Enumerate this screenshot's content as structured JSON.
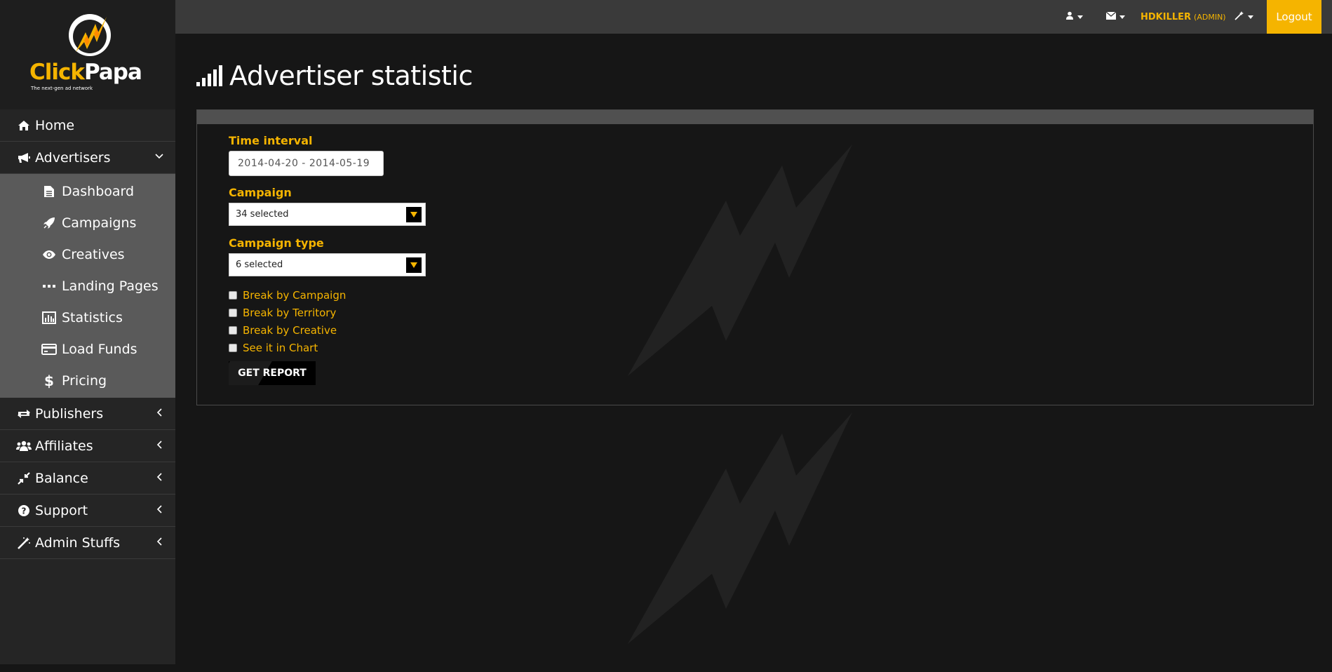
{
  "brand": {
    "name_part1": "Click",
    "name_part2": "Papa",
    "tagline": "The next-gen ad network",
    "accent_color": "#f5b400"
  },
  "sidebar": {
    "items": [
      {
        "label": "Home",
        "icon": "home-icon"
      },
      {
        "label": "Advertisers",
        "icon": "bullhorn-icon",
        "expanded": true,
        "children": [
          {
            "label": "Dashboard",
            "icon": "document-icon"
          },
          {
            "label": "Campaigns",
            "icon": "rocket-icon"
          },
          {
            "label": "Creatives",
            "icon": "eye-icon"
          },
          {
            "label": "Landing Pages",
            "icon": "ellipsis-icon"
          },
          {
            "label": "Statistics",
            "icon": "bar-chart-icon"
          },
          {
            "label": "Load Funds",
            "icon": "credit-card-icon"
          },
          {
            "label": "Pricing",
            "icon": "dollar-icon"
          }
        ]
      },
      {
        "label": "Publishers",
        "icon": "exchange-icon"
      },
      {
        "label": "Affiliates",
        "icon": "users-icon"
      },
      {
        "label": "Balance",
        "icon": "compress-icon"
      },
      {
        "label": "Support",
        "icon": "question-icon"
      },
      {
        "label": "Admin Stuffs",
        "icon": "magic-wand-icon"
      }
    ]
  },
  "topbar": {
    "user_name": "HDKILLER",
    "user_role": "(ADMIN)",
    "logout_label": "Logout"
  },
  "page": {
    "title": "Advertiser statistic"
  },
  "form": {
    "time_interval_label": "Time interval",
    "time_interval_value": "2014-04-20 - 2014-05-19",
    "campaign_label": "Campaign",
    "campaign_value": "34 selected",
    "campaign_type_label": "Campaign type",
    "campaign_type_value": "6 selected",
    "checkboxes": [
      {
        "label": "Break by Campaign",
        "checked": false
      },
      {
        "label": "Break by Territory",
        "checked": false
      },
      {
        "label": "Break by Creative",
        "checked": false
      },
      {
        "label": "See it in Chart",
        "checked": false
      }
    ],
    "submit_label": "GET REPORT"
  }
}
